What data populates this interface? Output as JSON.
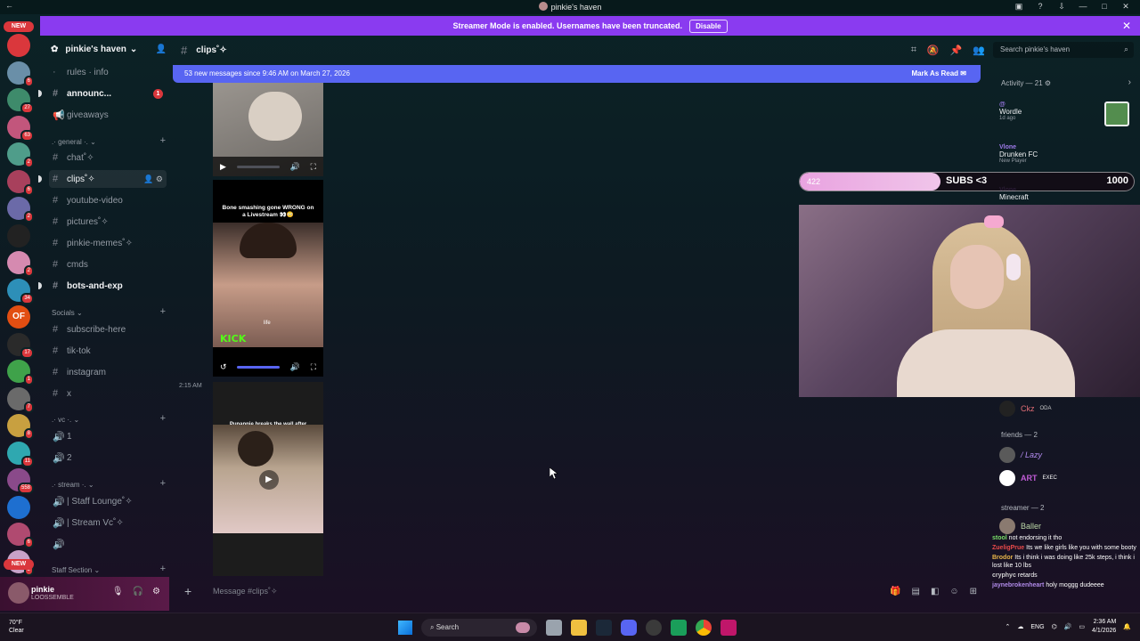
{
  "window": {
    "title": "pinkie's haven"
  },
  "banner": {
    "text": "Streamer Mode is enabled. Usernames have been truncated.",
    "button": "Disable"
  },
  "servers": [
    {
      "badge": ""
    },
    {
      "badge": "6"
    },
    {
      "badge": "27"
    },
    {
      "badge": "63"
    },
    {
      "badge": "2"
    },
    {
      "badge": "6"
    },
    {
      "badge": "2"
    },
    {
      "badge": ""
    },
    {
      "badge": "2"
    },
    {
      "badge": "34"
    },
    {
      "badge": ""
    },
    {
      "badge": "17"
    },
    {
      "badge": "1"
    },
    {
      "badge": "7"
    },
    {
      "badge": "8"
    },
    {
      "badge": "11"
    },
    {
      "badge": "558"
    },
    {
      "badge": ""
    },
    {
      "badge": "6"
    },
    {
      "badge": "2"
    }
  ],
  "server_new_label": "NEW",
  "server_of_label": "OF",
  "server": {
    "name": "pinkie's haven"
  },
  "channels": [
    {
      "name": "rules · info",
      "prefix": "·",
      "type": "rules"
    },
    {
      "name": "announc...",
      "prefix": "#",
      "bold": true,
      "unread": "1"
    },
    {
      "name": "giveaways",
      "prefix": "📢"
    },
    {
      "name": "chat˚✧",
      "prefix": "#"
    },
    {
      "name": "clips˚✧",
      "prefix": "#",
      "active": true
    },
    {
      "name": "youtube-video",
      "prefix": "#"
    },
    {
      "name": "pictures˚✧",
      "prefix": "#"
    },
    {
      "name": "pinkie-memes˚✧",
      "prefix": "#"
    },
    {
      "name": "cmds",
      "prefix": "#"
    },
    {
      "name": "bots-and-exp",
      "prefix": "#",
      "bold": true
    },
    {
      "name": "subscribe-here",
      "prefix": "#"
    },
    {
      "name": "tik-tok",
      "prefix": "#"
    },
    {
      "name": "instagram",
      "prefix": "#"
    },
    {
      "name": "x",
      "prefix": "#"
    },
    {
      "name": "1",
      "prefix": "🔊"
    },
    {
      "name": "2",
      "prefix": "🔊"
    },
    {
      "name": "| Staff Lounge˚✧",
      "prefix": "🔊"
    },
    {
      "name": "| Stream Vc˚✧",
      "prefix": "🔊"
    },
    {
      "name": "",
      "prefix": "🔊"
    }
  ],
  "categories": {
    "general": ".· general ·.",
    "socials": "Socials",
    "vc": ".· vc ·.",
    "stream": ".· stream ·.",
    "staff": "Staff Section"
  },
  "user": {
    "name": "pinkie",
    "status": "LOOSSEMBLE"
  },
  "chat": {
    "channel": "clips˚✧",
    "new_messages": "53 new messages since 9:46 AM on March 27, 2026",
    "mark_read": "Mark As Read",
    "timestamp": "2:15 AM",
    "placeholder": "Message #clips˚✧"
  },
  "videos": [
    {
      "caption": ""
    },
    {
      "caption": "Bone smashing gone WRONG on a Livestream 👀😳",
      "kick": "KICK",
      "tag": "life"
    },
    {
      "caption": "Punannie breaks the wall after getting an eviction notice 😩"
    }
  ],
  "search": {
    "placeholder": "Search pinkie's haven"
  },
  "activity": {
    "title": "Activity — 21",
    "items": [
      {
        "user": "@",
        "game": "Wordle",
        "sub": "1d ago"
      },
      {
        "user": "Vlone",
        "game": "Drunken FC",
        "sub": "New Player"
      },
      {
        "user": "Vlone",
        "game": "Minecraft",
        "sub": ""
      }
    ]
  },
  "subgoal": {
    "current": "422",
    "label": "SUBS <3",
    "goal": "1000",
    "progress": 0.422
  },
  "members": {
    "ckz": "Ckz",
    "ckz_tag": "ODA",
    "friends_header": "friends — 2",
    "friends": [
      "/ Lazy",
      "ART",
      "EXEC"
    ],
    "streamer_header": "streamer — 2",
    "streamer": "Baller"
  },
  "chatlog": [
    {
      "name": "stool",
      "text": "not endorsing it tho"
    },
    {
      "name": "ZueligPrue",
      "text": "Its we like girls like you with some booty"
    },
    {
      "name": "Brodor",
      "text": "Its i think i was doing like 25k steps, i think i lost like 10 lbs"
    },
    {
      "name": "cryphyc",
      "text": "retards"
    },
    {
      "name": "jaynebrokenheart",
      "text": "holy moggg dudeeee"
    }
  ],
  "taskbar": {
    "temp": "70°F",
    "weather": "Clear",
    "search": "Search",
    "lang": "ENG",
    "time": "2:36 AM",
    "date": "4/1/2026"
  },
  "colors": {
    "accent": "#5865f2",
    "banner": "#8a3bf0",
    "kick": "#53fc18"
  }
}
